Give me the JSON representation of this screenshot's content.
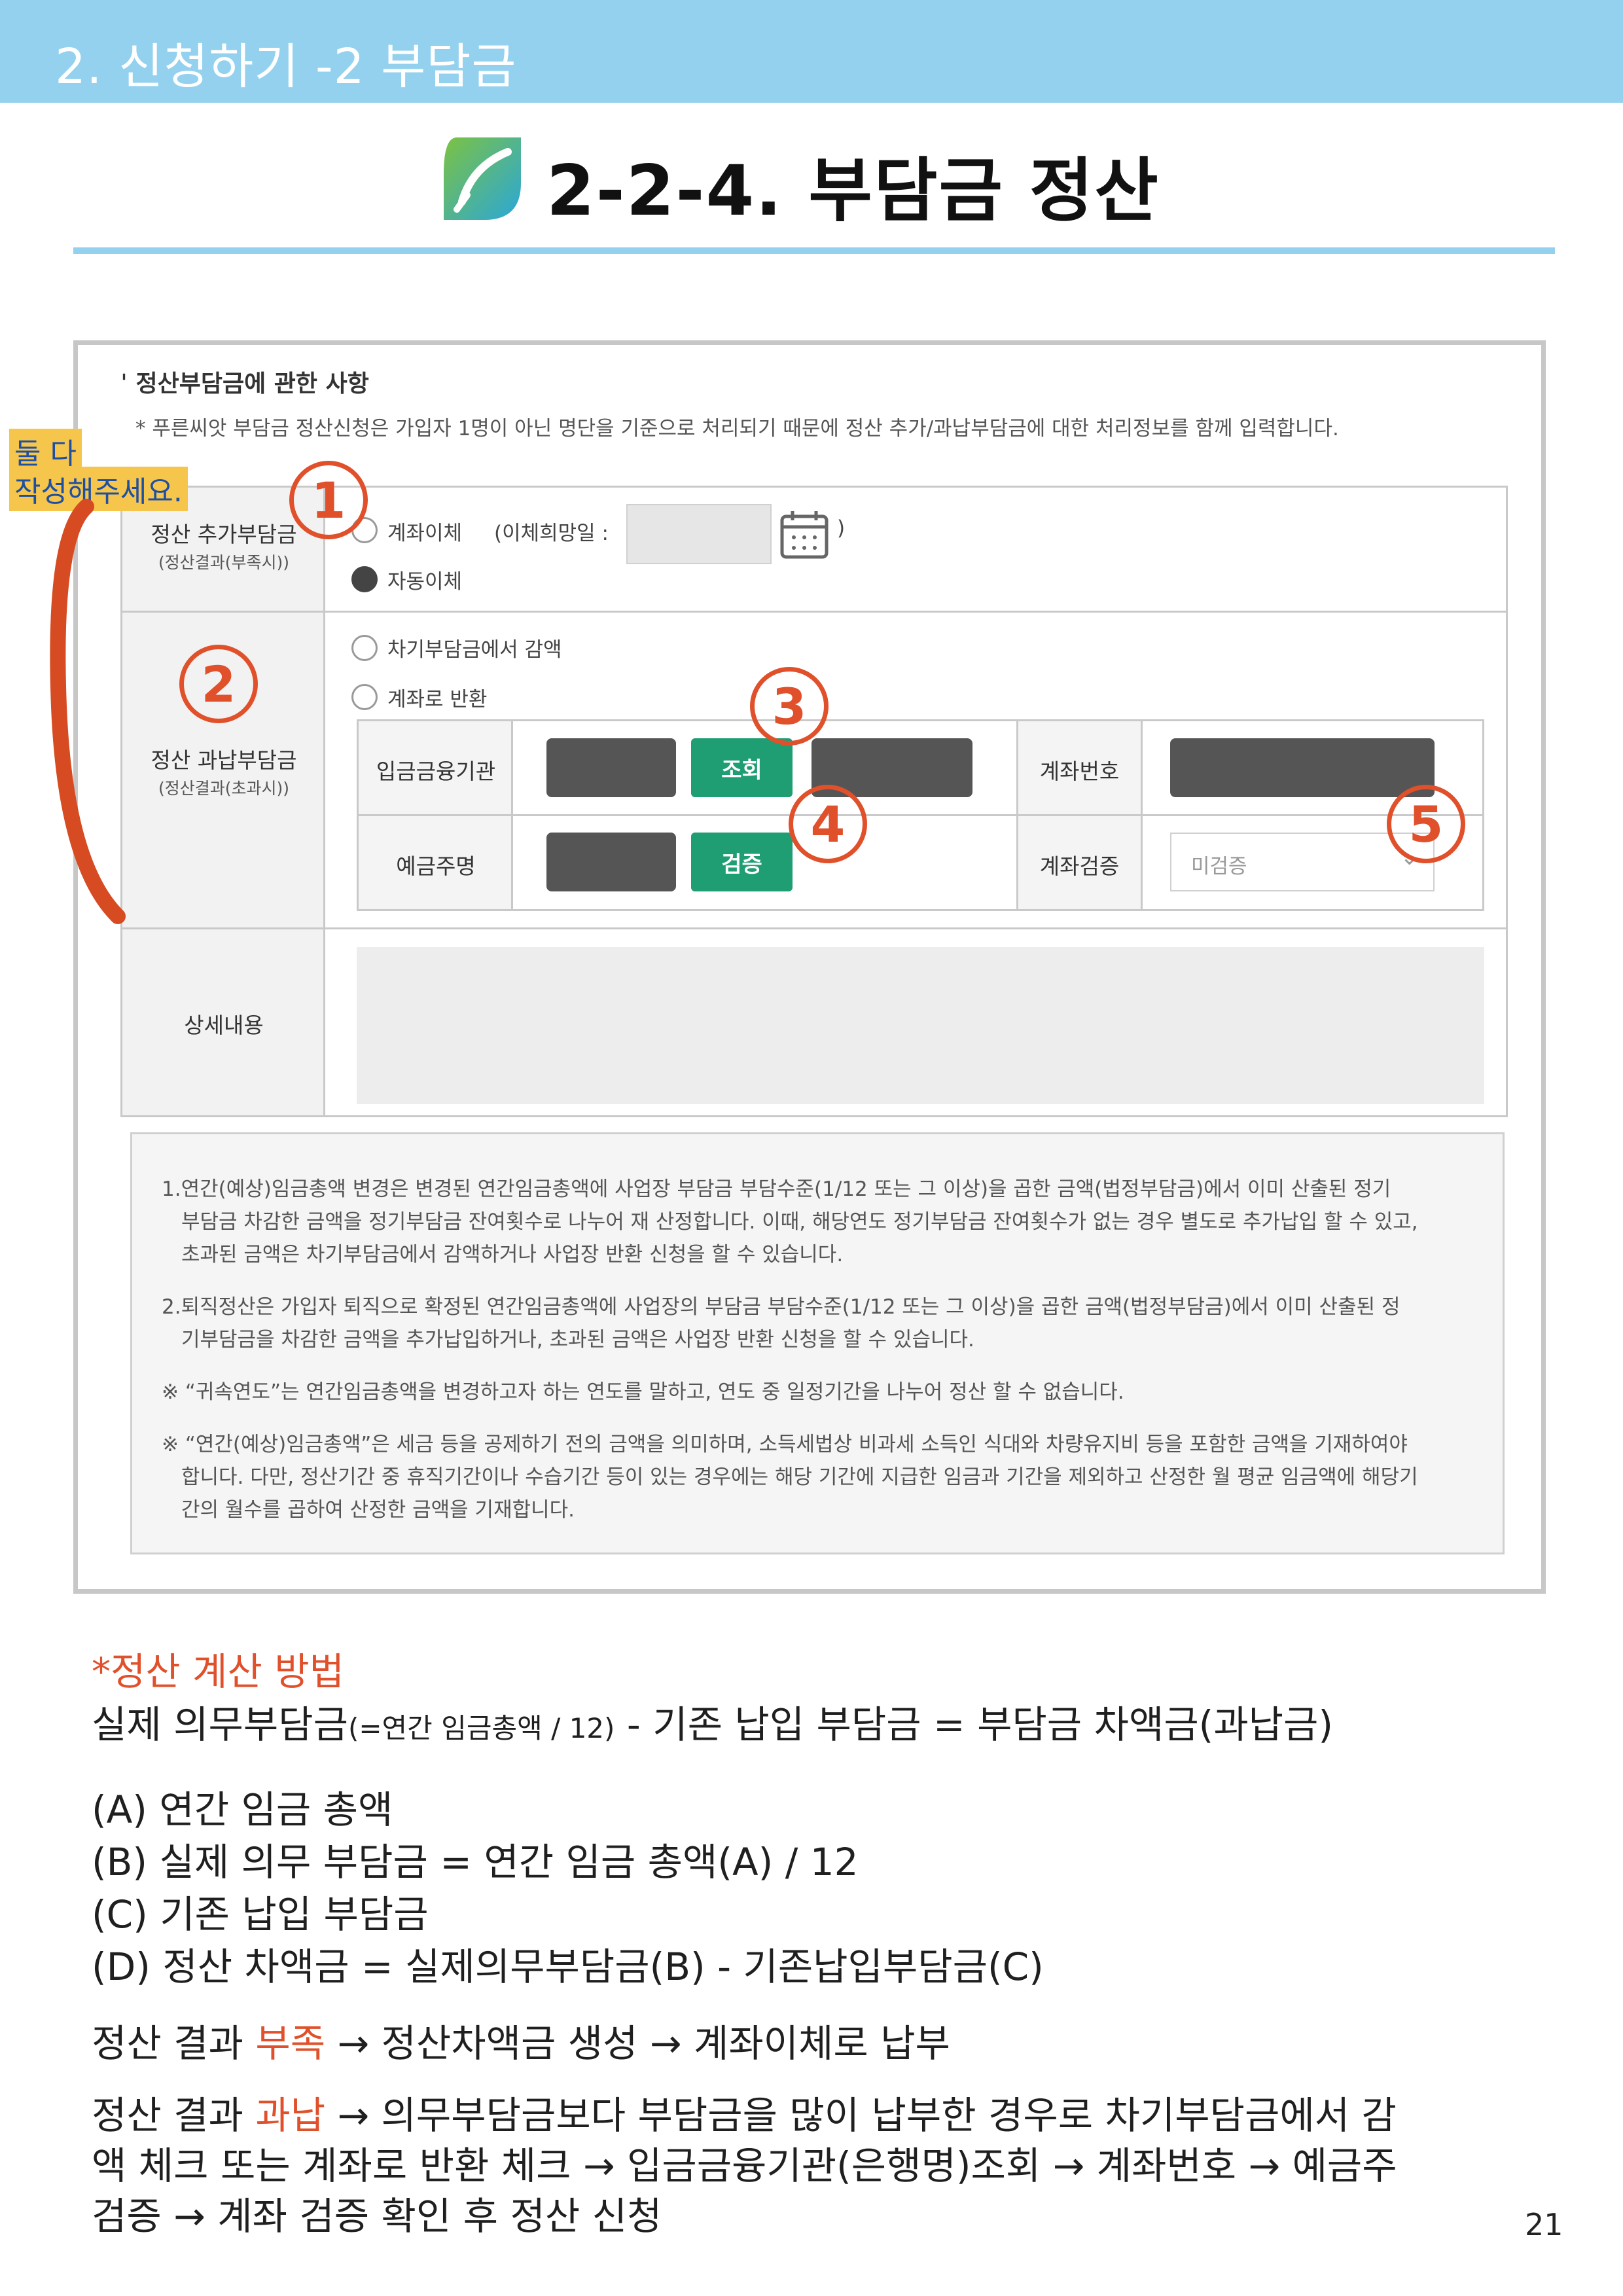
{
  "header": {
    "title": "2. 신청하기 -2 부담금"
  },
  "page": {
    "title": "2-2-4. 부담금 정산",
    "number": "21"
  },
  "sticky_note": {
    "line1": "둘 다",
    "line2": "작성해주세요."
  },
  "form": {
    "section_title": "ˈ 정산부담금에 관한 사항",
    "section_note": "* 푸른씨앗 부담금 정산신청은 가입자 1명이 아닌 명단을 기준으로 처리되기 때문에  정산 추가/과납부담금에 대한 처리정보를 함께 입력합니다.",
    "row1": {
      "label": "정산 추가부담금",
      "sublabel": "(정산결과(부족시))",
      "opt_transfer": "계좌이체",
      "opt_transfer_date_label": "(이체희망일 :",
      "opt_transfer_close": ")",
      "opt_auto": "자동이체"
    },
    "row2": {
      "label": "정산 과납부담금",
      "sublabel": "(정산결과(초과시))",
      "opt_deduct": "차기부담금에서 감액",
      "opt_refund": "계좌로 반환",
      "bank_label": "입금금융기관",
      "lookup_button": "조회",
      "account_label": "계좌번호",
      "holder_label": "예금주명",
      "verify_button": "검증",
      "verify_status_label": "계좌검증",
      "verify_status_value": "미검증"
    },
    "row3": {
      "label": "상세내용"
    },
    "annotations": [
      "1",
      "2",
      "3",
      "4",
      "5"
    ],
    "info": [
      "1.연간(예상)임금총액 변경은 변경된 연간임금총액에 사업장 부담금 부담수준(1/12 또는 그 이상)을 곱한 금액(법정부담금)에서 이미 산출된 정기",
      "부담금 차감한 금액을 정기부담금 잔여횟수로 나누어 재 산정합니다. 이때, 해당연도 정기부담금 잔여횟수가 없는 경우 별도로 추가납입 할 수 있고,",
      "초과된 금액은 차기부담금에서 감액하거나 사업장 반환 신청을 할 수 있습니다.",
      "2.퇴직정산은 가입자 퇴직으로 확정된 연간임금총액에 사업장의 부담금 부담수준(1/12 또는 그 이상)을 곱한 금액(법정부담금)에서 이미 산출된 정",
      "기부담금을 차감한 금액을 추가납입하거나, 초과된 금액은 사업장 반환 신청을 할 수 있습니다.",
      "※ “귀속연도”는 연간임금총액을 변경하고자 하는 연도를 말하고, 연도 중 일정기간을 나누어 정산 할 수 없습니다.",
      "※ “연간(예상)임금총액”은 세금 등을 공제하기 전의 금액을 의미하며, 소득세법상 비과세 소득인 식대와 차량유지비 등을 포함한 금액을 기재하여야",
      "합니다. 다만, 정산기간 중 휴직기간이나 수습기간 등이 있는 경우에는 해당 기간에 지급한 임금과 기간을 제외하고 산정한 월 평균 임금액에 해당기",
      "간의 월수를 곱하여 산정한 금액을 기재합니다."
    ]
  },
  "explain": {
    "heading": "*정산 계산 방법",
    "formula_a": "실제 의무부담금",
    "formula_b": "(=연간 임금총액 / 12)",
    "formula_c": " - 기존 납입 부담금 = 부담금 차액금(과납금)",
    "items": [
      "(A) 연간 임금 총액",
      "(B) 실제 의무 부담금 = 연간 임금 총액(A) / 12",
      "(C) 기존 납입 부담금",
      "(D) 정산 차액금 = 실제의무부담금(B) - 기존납입부담금(C)"
    ],
    "shortage_prefix": "정산 결과 ",
    "shortage_word": "부족",
    "shortage_suffix": " → 정산차액금 생성 → 계좌이체로 납부",
    "excess_prefix": "정산 결과 ",
    "excess_word": "과납",
    "excess_line1": " → 의무부담금보다 부담금을 많이 납부한 경우로 차기부담금에서 감",
    "excess_line2": "액 체크 또는 계좌로 반환 체크 → 입금금융기관(은행명)조회 → 계좌번호 → 예금주",
    "excess_line3": "검증 → 계좌 검증 확인 후 정산 신청"
  },
  "colors": {
    "header": "#93d1ee",
    "accent_green": "#1f9e73",
    "annotation": "#e0502b"
  }
}
